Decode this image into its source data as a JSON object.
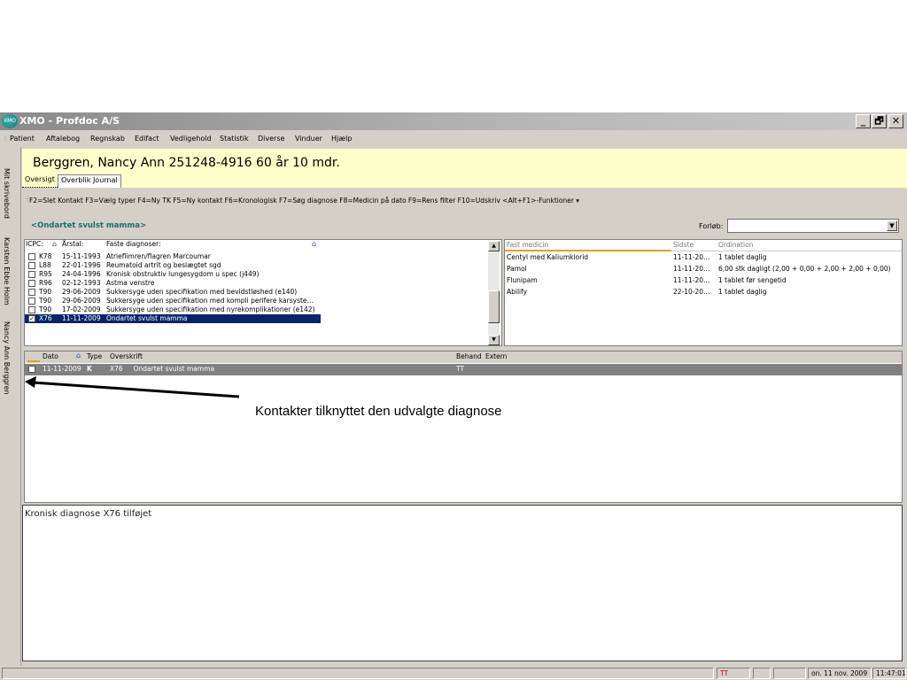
{
  "window": {
    "title": "XMO - Profdoc A/S",
    "icon_text": "XMO",
    "buttons": [
      "_",
      "🗗",
      "✕"
    ]
  },
  "menu": [
    "Patient",
    "Aftalebog",
    "Regnskab",
    "Edifact",
    "Vedligehold",
    "Statistik",
    "Diverse",
    "Vinduer",
    "Hjælp"
  ],
  "left_tabs": [
    "Mit skrivebord",
    "Karsten Ebbe Holm",
    "Nancy Ann Berggren"
  ],
  "patient": {
    "header": "Berggren, Nancy Ann 251248-4916   60 år 10 mdr."
  },
  "tabs": [
    "Oversigt",
    "Overblik Journal"
  ],
  "function_keys": "F2=Slet Kontakt  F3=Vælg typer  F4=Ny TK  F5=Ny kontakt  F6=Kronologisk  F7=Søg diagnose  F8=Medicin på dato  F9=Rens filter  F10=Udskriv  <Alt+F1>-Funktioner ▾",
  "diagnosis_title": "<Ondartet svulst mamma>",
  "forloeb": {
    "label": "Forløb:",
    "value": ""
  },
  "diag_list": {
    "headers": {
      "icpc": "ICPC:",
      "year": "Årstal:",
      "diag": "Faste diagnoser:"
    },
    "rows": [
      {
        "code": "K78",
        "date": "15-11-1993",
        "text": "Atrieflimren/flagren Marcoumar",
        "checked": false
      },
      {
        "code": "L88",
        "date": "22-01-1996",
        "text": "Reumatoid artrit og beslægtet sgd",
        "checked": false
      },
      {
        "code": "R95",
        "date": "24-04-1996",
        "text": "Kronisk obstruktiv lungesygdom u spec (j449)",
        "checked": false
      },
      {
        "code": "R96",
        "date": "02-12-1993",
        "text": "Astma venstre",
        "checked": false
      },
      {
        "code": "T90",
        "date": "29-06-2009",
        "text": "Sukkersyge uden specifikation med bevidstløshed (e140)",
        "checked": false
      },
      {
        "code": "T90",
        "date": "29-06-2009",
        "text": "Sukkersyge uden specifikation med kompli perifere karsyste…",
        "checked": false
      },
      {
        "code": "T90",
        "date": "17-02-2009",
        "text": "Sukkersyge uden specifikation med nyrekomplikationer (e142)",
        "checked": false
      },
      {
        "code": "X76",
        "date": "11-11-2009",
        "text": "Ondartet svulst mamma",
        "checked": true
      }
    ]
  },
  "med_panel": {
    "headers": {
      "name": "Fast medicin",
      "last": "Sidste",
      "ordination": "Ordination"
    },
    "rows": [
      {
        "name": "Centyl med Kaliumklorid",
        "last": "11-11-20…",
        "ord": "1 tablet daglig"
      },
      {
        "name": "Pamol",
        "last": "11-11-20…",
        "ord": "6,00 stk dagligt (2,00 + 0,00 + 2,00 + 2,00 + 0,00)"
      },
      {
        "name": "Flunipam",
        "last": "11-11-20…",
        "ord": "1 tablet før sengetid"
      },
      {
        "name": "Abilify",
        "last": "22-10-20…",
        "ord": "1 tablet daglig"
      }
    ]
  },
  "contacts": {
    "headers": {
      "date": "Dato",
      "type": "Type",
      "heading": "Overskrift",
      "behand": "Behand",
      "extern": "Extern"
    },
    "rows": [
      {
        "date": "11-11-2009",
        "type": "K",
        "heading": "X76     Ondartet svulst mamma",
        "behand": "TT",
        "extern": ""
      }
    ]
  },
  "note": "Kronisk diagnose X76 tilføjet",
  "annotation": "Kontakter tilknyttet den udvalgte diagnose",
  "statusbar": {
    "user": "TT",
    "date": "on. 11 nov. 2009",
    "time": "11:47:01"
  },
  "colors": {
    "selection": "#0a246a",
    "diag_title": "#1d6e68",
    "header_bg": "#ffffcc",
    "status_user": "#cc0000"
  }
}
